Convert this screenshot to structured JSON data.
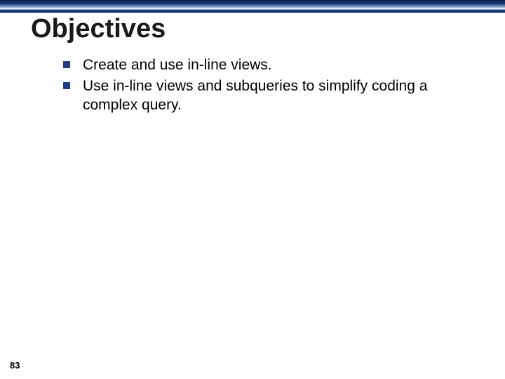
{
  "title": "Objectives",
  "bullets": [
    "Create and use in-line views.",
    "Use in-line views and subqueries to simplify coding a complex query."
  ],
  "pageNumber": "83"
}
